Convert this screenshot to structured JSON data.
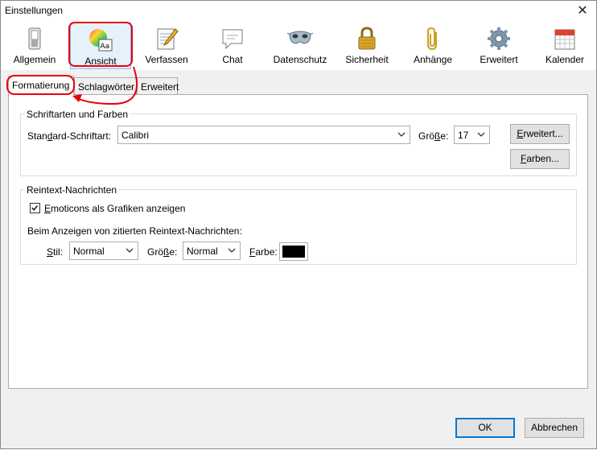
{
  "window": {
    "title": "Einstellungen",
    "close_glyph": "✕"
  },
  "toolbar": {
    "items": [
      {
        "label": "Allgemein",
        "icon": "toggle-switch-icon"
      },
      {
        "label": "Ansicht",
        "icon": "color-palette-icon",
        "selected": true
      },
      {
        "label": "Verfassen",
        "icon": "notepad-pencil-icon"
      },
      {
        "label": "Chat",
        "icon": "speech-bubble-icon"
      },
      {
        "label": "Datenschutz",
        "icon": "mask-icon"
      },
      {
        "label": "Sicherheit",
        "icon": "padlock-icon"
      },
      {
        "label": "Anhänge",
        "icon": "paperclip-icon"
      },
      {
        "label": "Erweitert",
        "icon": "gear-icon"
      },
      {
        "label": "Kalender",
        "icon": "calendar-icon"
      }
    ]
  },
  "tabs": [
    {
      "label": "Formatierung",
      "active": true
    },
    {
      "label": "Schlagwörter"
    },
    {
      "label": "Erweitert"
    }
  ],
  "fonts_group": {
    "title": "Schriftarten und Farben",
    "standard_font_label_pre": "Stan",
    "standard_font_label_u": "d",
    "standard_font_label_post": "ard-Schriftart:",
    "standard_font_value": "Calibri",
    "size_label_pre": "Grö",
    "size_label_u": "ß",
    "size_label_post": "e:",
    "size_value": "17",
    "advanced_button_u": "E",
    "advanced_button_rest": "rweitert...",
    "colors_button_u": "F",
    "colors_button_rest": "arben..."
  },
  "plaintext_group": {
    "title": "Reintext-Nachrichten",
    "emoticons_checked": true,
    "emoticons_label_u": "E",
    "emoticons_label_rest": "moticons als Grafiken anzeigen",
    "quoted_heading": "Beim Anzeigen von zitierten Reintext-Nachrichten:",
    "style_label_u": "S",
    "style_label_rest": "til:",
    "style_value": "Normal",
    "size_label_pre": "Grö",
    "size_label_u": "ß",
    "size_label_post": "e:",
    "size_value": "Normal",
    "color_label_u": "F",
    "color_label_rest": "arbe:",
    "color_value": "#000000"
  },
  "footer": {
    "ok_label": "OK",
    "cancel_label": "Abbrechen"
  },
  "colors": {
    "highlight": "#e8000d",
    "selected_bg": "#e5f1fb",
    "default_border": "#0078d7"
  }
}
